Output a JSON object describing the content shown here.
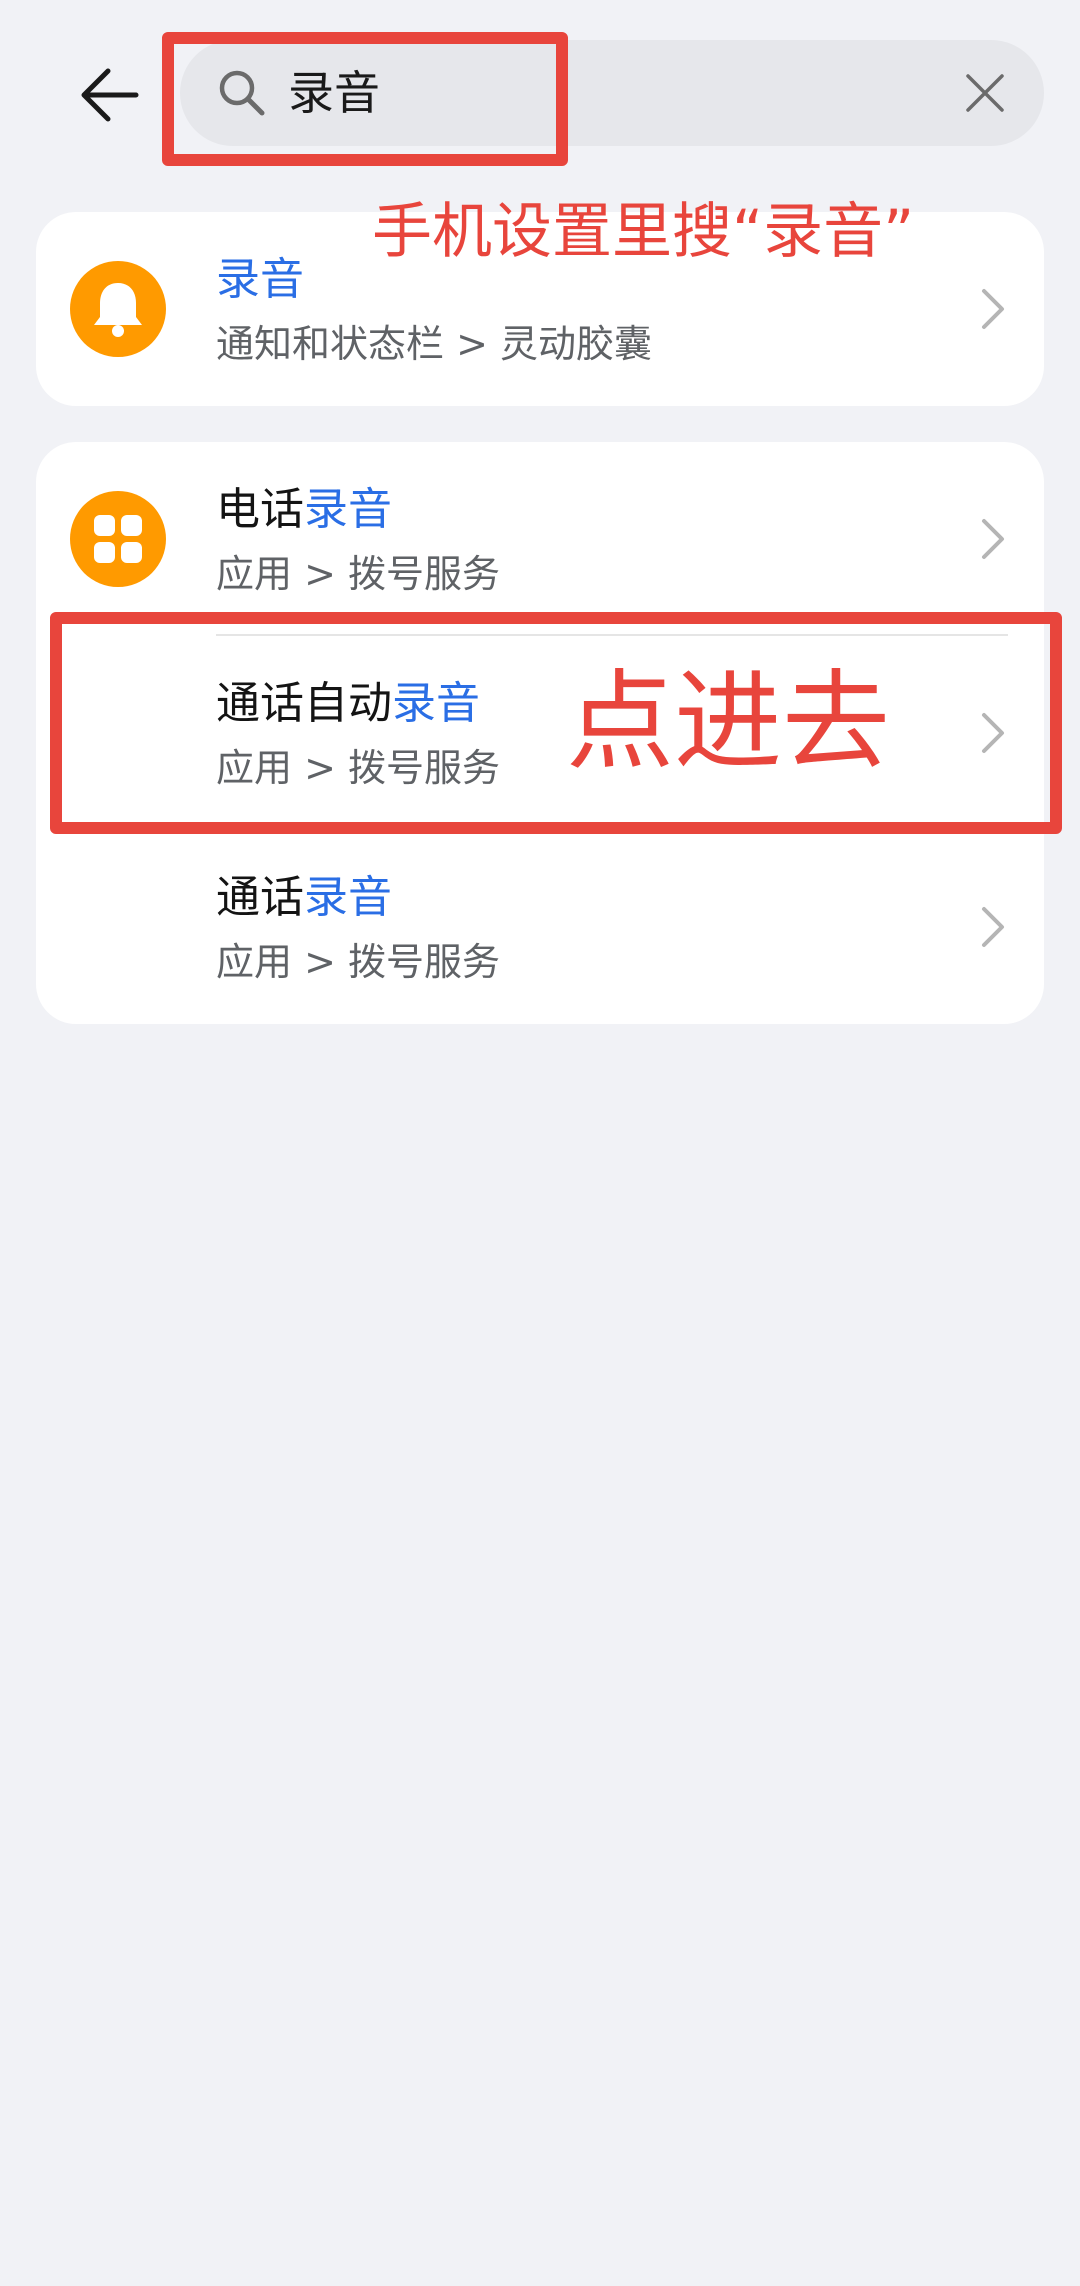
{
  "header": {
    "back_icon": "arrow-left-icon",
    "search": {
      "icon": "search-icon",
      "query": "录音",
      "clear_icon": "close-icon"
    }
  },
  "results": {
    "group1": [
      {
        "icon": "bell-icon",
        "title_plain": "",
        "title_highlight": "录音",
        "subtitle": "通知和状态栏 > 灵动胶囊"
      }
    ],
    "group2": [
      {
        "icon": "apps-grid-icon",
        "title_plain": "电话",
        "title_highlight": "录音",
        "subtitle": "应用 > 拨号服务"
      },
      {
        "icon": "",
        "title_plain": "通话自动",
        "title_highlight": "录音",
        "subtitle": "应用 > 拨号服务"
      },
      {
        "icon": "",
        "title_plain": "通话",
        "title_highlight": "录音",
        "subtitle": "应用 > 拨号服务"
      }
    ]
  },
  "annotations": {
    "search_hint": "手机设置里搜“录音”",
    "tap_hint": "点进去",
    "color": "#e8453c"
  },
  "colors": {
    "background": "#f1f2f6",
    "card": "#ffffff",
    "highlight": "#2a6ee5",
    "icon_orange": "#ff9a00"
  }
}
